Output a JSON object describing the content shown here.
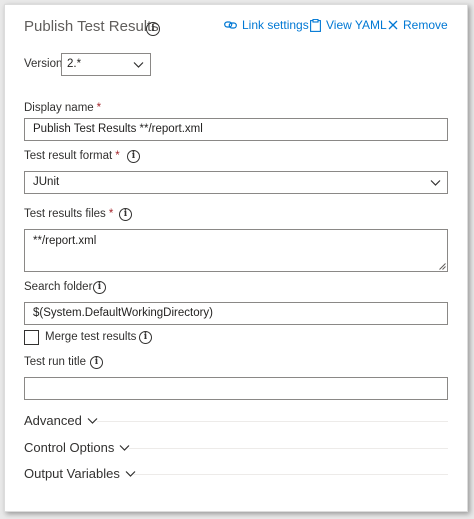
{
  "header": {
    "title": "Publish Test Results",
    "link_settings": "Link settings",
    "view_yaml": "View YAML",
    "remove": "Remove"
  },
  "version": {
    "label": "Version",
    "value": "2.*"
  },
  "display_name": {
    "label": "Display name",
    "required_mark": "*",
    "value": "Publish Test Results **/report.xml"
  },
  "test_result_format": {
    "label": "Test result format",
    "required_mark": "*",
    "value": "JUnit"
  },
  "test_results_files": {
    "label": "Test results files",
    "required_mark": "*",
    "value": "**/report.xml"
  },
  "search_folder": {
    "label": "Search folder",
    "value": "$(System.DefaultWorkingDirectory)"
  },
  "merge_test_results": {
    "label": "Merge test results",
    "checked": false
  },
  "test_run_title": {
    "label": "Test run title",
    "value": ""
  },
  "sections": {
    "advanced": "Advanced",
    "control_options": "Control Options",
    "output_variables": "Output Variables"
  },
  "colors": {
    "accent": "#0078d4",
    "required": "#a4262c"
  }
}
